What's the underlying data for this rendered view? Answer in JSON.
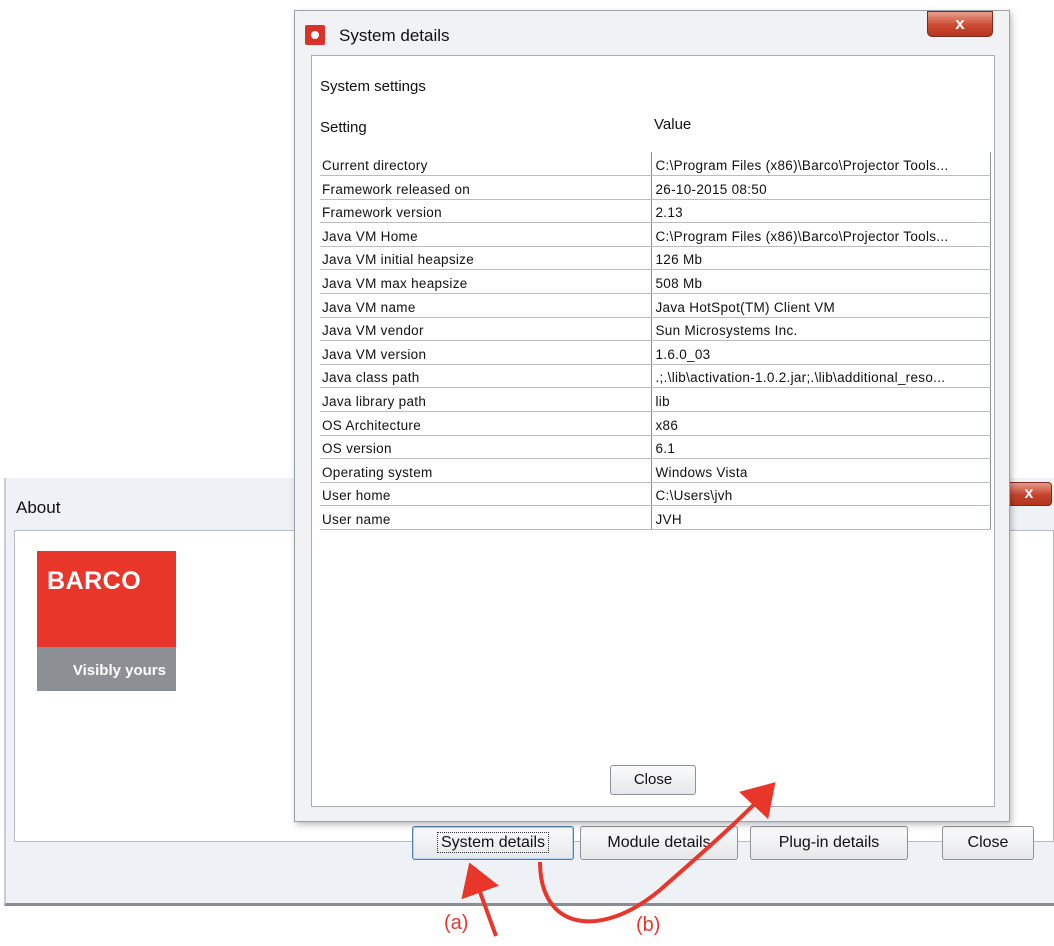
{
  "about_window": {
    "title": "About",
    "close_glyph": "x",
    "logo": {
      "brand": "BARCO",
      "tagline": "Visibly yours",
      "brand_color": "#e8372a"
    },
    "buttons": {
      "system_details": "System details",
      "module_details": "Module details",
      "plugin_details": "Plug-in details",
      "close": "Close"
    }
  },
  "system_details_dialog": {
    "title": "System details",
    "close_glyph": "x",
    "section_title": "System settings",
    "columns": {
      "setting": "Setting",
      "value": "Value"
    },
    "rows": [
      {
        "setting": "Current directory",
        "value": "C:\\Program Files (x86)\\Barco\\Projector Tools..."
      },
      {
        "setting": "Framework released on",
        "value": "26-10-2015 08:50"
      },
      {
        "setting": "Framework version",
        "value": "2.13"
      },
      {
        "setting": "Java VM Home",
        "value": "C:\\Program Files (x86)\\Barco\\Projector Tools..."
      },
      {
        "setting": "Java VM initial heapsize",
        "value": "126 Mb"
      },
      {
        "setting": "Java VM max heapsize",
        "value": "508 Mb"
      },
      {
        "setting": "Java VM name",
        "value": "Java HotSpot(TM) Client VM"
      },
      {
        "setting": "Java VM vendor",
        "value": "Sun Microsystems Inc."
      },
      {
        "setting": "Java VM version",
        "value": "1.6.0_03"
      },
      {
        "setting": "Java class path",
        "value": ".;.\\lib\\activation-1.0.2.jar;.\\lib\\additional_reso..."
      },
      {
        "setting": "Java library path",
        "value": "lib"
      },
      {
        "setting": "OS Architecture",
        "value": "x86"
      },
      {
        "setting": "OS version",
        "value": "6.1"
      },
      {
        "setting": "Operating system",
        "value": "Windows Vista"
      },
      {
        "setting": "User home",
        "value": "C:\\Users\\jvh"
      },
      {
        "setting": "User name",
        "value": "JVH"
      }
    ],
    "close_button": "Close"
  },
  "annotations": {
    "a": "(a)",
    "b": "(b)",
    "arrow_color": "#e8372a"
  }
}
